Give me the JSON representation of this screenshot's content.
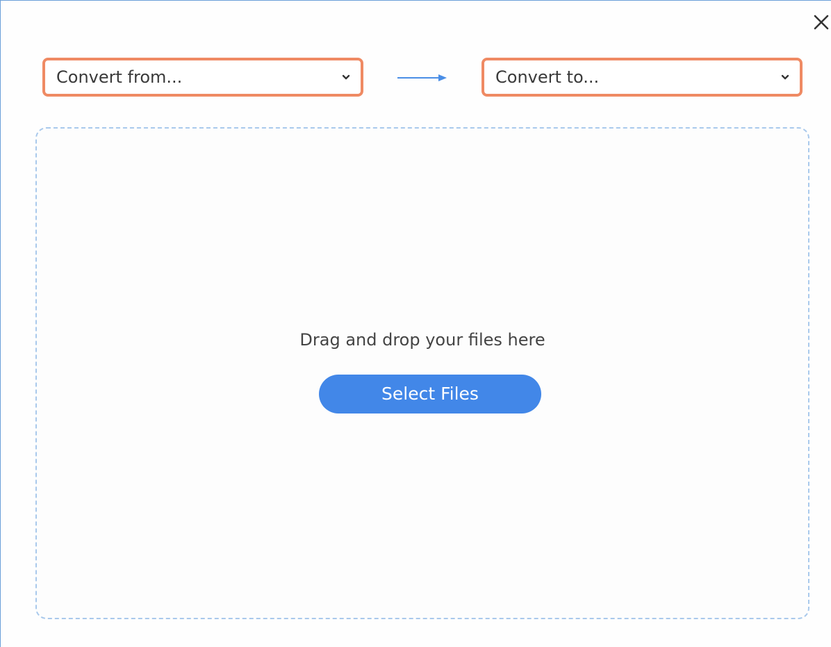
{
  "dialog": {
    "close_icon": "close-icon",
    "convert_from": {
      "label": "Convert from...",
      "icon": "chevron-down-icon",
      "border_color": "#ef8a63"
    },
    "arrow_icon": "arrow-right-icon",
    "convert_to": {
      "label": "Convert to...",
      "icon": "chevron-down-icon",
      "border_color": "#ef8a63"
    },
    "drop_zone": {
      "instruction": "Drag and drop your files here",
      "select_button_label": "Select Files",
      "button_color": "#4287e8",
      "border_color": "#a9c9ec"
    }
  }
}
